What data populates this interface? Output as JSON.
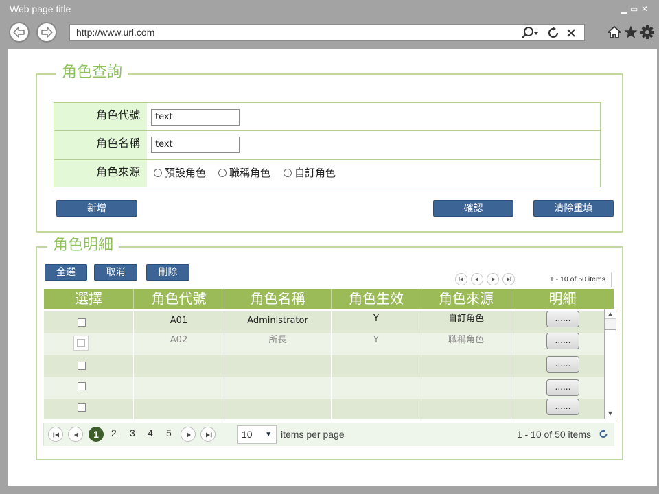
{
  "window": {
    "title": "Web page title"
  },
  "browser": {
    "url": "http://www.url.com"
  },
  "query": {
    "legend": "角色查詢",
    "fields": [
      {
        "label": "角色代號",
        "value": "text"
      },
      {
        "label": "角色名稱",
        "value": "text"
      }
    ],
    "source": {
      "label": "角色來源",
      "options": [
        "預設角色",
        "職稱角色",
        "自訂角色"
      ]
    },
    "buttons": {
      "add": "新增",
      "confirm": "確認",
      "clear": "清除重填"
    }
  },
  "details": {
    "legend": "角色明細",
    "actions": {
      "select_all": "全選",
      "cancel": "取消",
      "delete": "刪除"
    },
    "top_pager_info": "1 - 10 of 50 items",
    "columns": [
      "選擇",
      "角色代號",
      "角色名稱",
      "角色生效",
      "角色來源",
      "明細"
    ],
    "rows": [
      {
        "code": "A01",
        "name": "Administrator",
        "active": "Y",
        "source": "自訂角色",
        "detail": "......"
      },
      {
        "code": "A02",
        "name": "所長",
        "active": "Y",
        "source": "職稱角色",
        "detail": "......"
      },
      {
        "code": "",
        "name": "",
        "active": "",
        "source": "",
        "detail": "......"
      },
      {
        "code": "",
        "name": "",
        "active": "",
        "source": "",
        "detail": "......"
      },
      {
        "code": "",
        "name": "",
        "active": "",
        "source": "",
        "detail": "......"
      }
    ],
    "pager": {
      "pages": [
        "1",
        "2",
        "3",
        "4",
        "5"
      ],
      "current_page": "1",
      "page_size": "10",
      "per_page_label": "items per page",
      "info": "1 - 10 of 50 items"
    }
  }
}
